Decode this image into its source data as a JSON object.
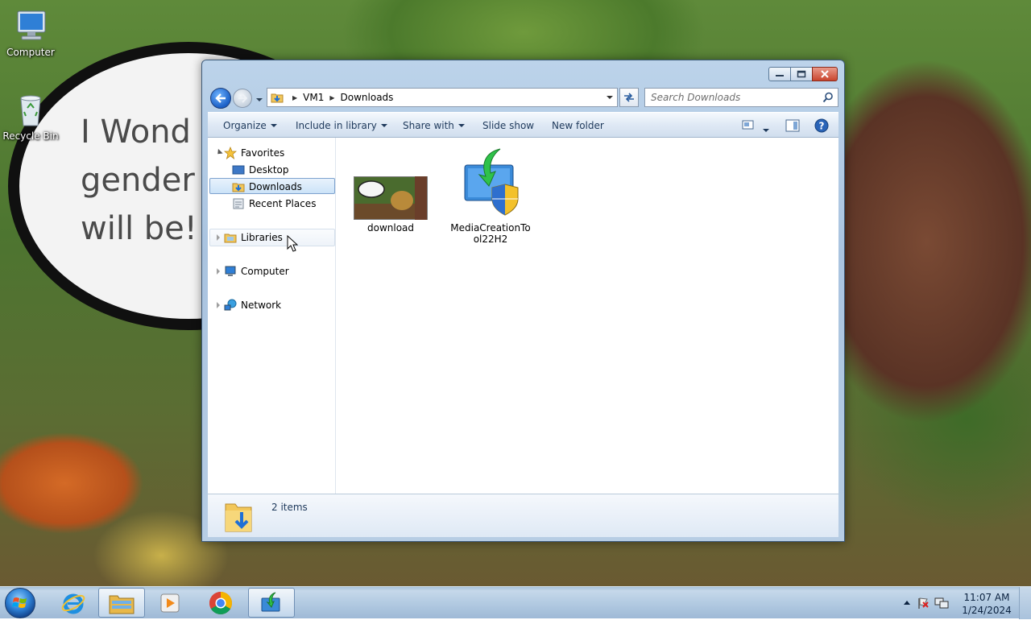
{
  "desktop": {
    "wallpaper_text": "I Wond\ngender\nwill be!",
    "icons": [
      {
        "label": "Computer",
        "icon": "computer-icon"
      },
      {
        "label": "Recycle Bin",
        "icon": "recycle-bin-icon"
      }
    ]
  },
  "window": {
    "caption_buttons": [
      "minimize-icon",
      "maximize-icon",
      "close-icon"
    ],
    "address": {
      "root_icon": "downloads-folder-icon",
      "crumbs": [
        "VM1",
        "Downloads"
      ]
    },
    "search": {
      "placeholder": "Search Downloads"
    },
    "commands": {
      "organize": "Organize",
      "include_in_library": "Include in library",
      "share_with": "Share with",
      "slide_show": "Slide show",
      "new_folder": "New folder"
    },
    "nav": {
      "favorites": "Favorites",
      "desktop": "Desktop",
      "downloads": "Downloads",
      "recent_places": "Recent Places",
      "libraries": "Libraries",
      "computer": "Computer",
      "network": "Network",
      "selected": "Downloads"
    },
    "files": [
      {
        "name": "download",
        "icon": "image-thumbnail-icon"
      },
      {
        "name": "MediaCreationTool22H2",
        "icon": "media-creation-tool-icon"
      }
    ],
    "status": {
      "item_count": "2 items"
    }
  },
  "taskbar": {
    "pinned": [
      "internet-explorer-icon",
      "windows-explorer-icon",
      "windows-media-player-icon",
      "chrome-icon",
      "media-creation-tool-icon"
    ],
    "active": "windows-explorer-icon",
    "clock": {
      "time": "11:07 AM",
      "date": "1/24/2024"
    }
  }
}
